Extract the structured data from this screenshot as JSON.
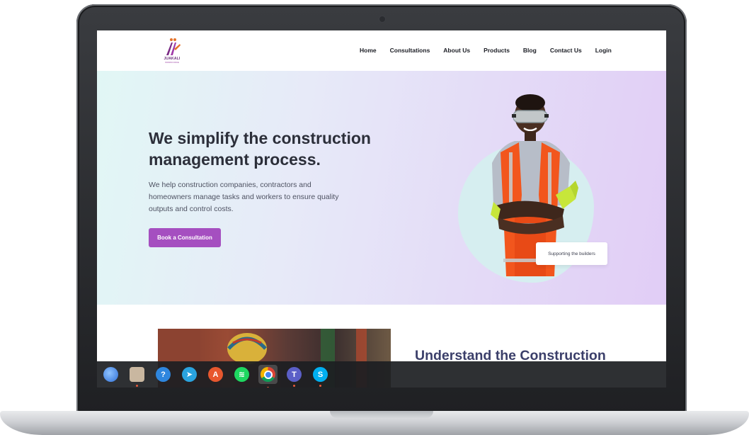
{
  "site": {
    "logo_text": "JUAKALI",
    "logo_subtext": "WORKFORCE",
    "nav": [
      "Home",
      "Consultations",
      "About Us",
      "Products",
      "Blog",
      "Contact Us",
      "Login"
    ]
  },
  "hero": {
    "title": "We simplify the construction management process.",
    "subtitle": "We help construction companies, contractors and homeowners manage tasks and workers to ensure quality outputs and control costs.",
    "cta": "Book a Consultation",
    "tag": "Supporting the builders"
  },
  "section2": {
    "heading": "Understand the Construction"
  },
  "dock": {
    "apps": [
      {
        "name": "thunderbird-icon",
        "color": "#2f6fd6",
        "glyph": "",
        "running": false
      },
      {
        "name": "files-icon",
        "color": "#c9b7a0",
        "glyph": "",
        "running": true
      },
      {
        "name": "help-icon",
        "color": "#2e86de",
        "glyph": "?",
        "running": false
      },
      {
        "name": "telegram-icon",
        "color": "#2aa3de",
        "glyph": "➤",
        "running": false
      },
      {
        "name": "app-center-icon",
        "color": "#e8572e",
        "glyph": "A",
        "running": false
      },
      {
        "name": "spotify-icon",
        "color": "#1ed760",
        "glyph": "≋",
        "running": false
      },
      {
        "name": "chrome-icon",
        "color": "#f4b400",
        "glyph": "",
        "running": true
      },
      {
        "name": "teams-icon",
        "color": "#5b5fc7",
        "glyph": "T",
        "running": true
      },
      {
        "name": "skype-icon",
        "color": "#00aff0",
        "glyph": "S",
        "running": true
      }
    ]
  }
}
